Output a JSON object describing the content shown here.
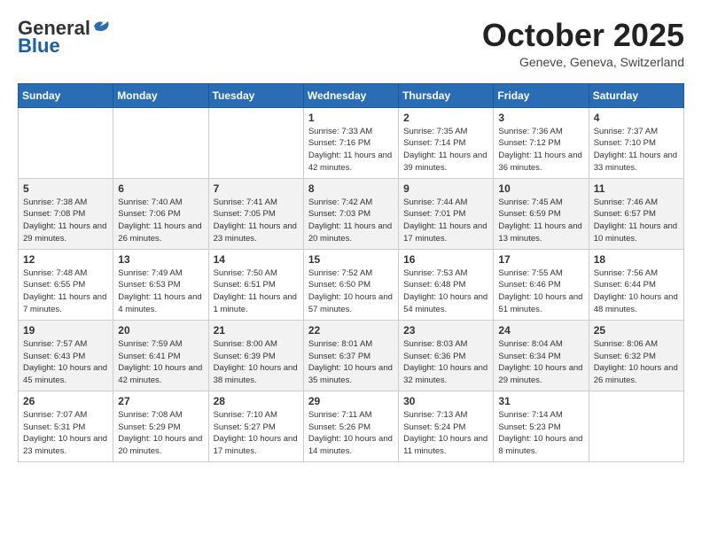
{
  "header": {
    "logo_general": "General",
    "logo_blue": "Blue",
    "month_title": "October 2025",
    "subtitle": "Geneve, Geneva, Switzerland"
  },
  "days_of_week": [
    "Sunday",
    "Monday",
    "Tuesday",
    "Wednesday",
    "Thursday",
    "Friday",
    "Saturday"
  ],
  "weeks": [
    [
      {
        "num": "",
        "sunrise": "",
        "sunset": "",
        "daylight": ""
      },
      {
        "num": "",
        "sunrise": "",
        "sunset": "",
        "daylight": ""
      },
      {
        "num": "",
        "sunrise": "",
        "sunset": "",
        "daylight": ""
      },
      {
        "num": "1",
        "sunrise": "Sunrise: 7:33 AM",
        "sunset": "Sunset: 7:16 PM",
        "daylight": "Daylight: 11 hours and 42 minutes."
      },
      {
        "num": "2",
        "sunrise": "Sunrise: 7:35 AM",
        "sunset": "Sunset: 7:14 PM",
        "daylight": "Daylight: 11 hours and 39 minutes."
      },
      {
        "num": "3",
        "sunrise": "Sunrise: 7:36 AM",
        "sunset": "Sunset: 7:12 PM",
        "daylight": "Daylight: 11 hours and 36 minutes."
      },
      {
        "num": "4",
        "sunrise": "Sunrise: 7:37 AM",
        "sunset": "Sunset: 7:10 PM",
        "daylight": "Daylight: 11 hours and 33 minutes."
      }
    ],
    [
      {
        "num": "5",
        "sunrise": "Sunrise: 7:38 AM",
        "sunset": "Sunset: 7:08 PM",
        "daylight": "Daylight: 11 hours and 29 minutes."
      },
      {
        "num": "6",
        "sunrise": "Sunrise: 7:40 AM",
        "sunset": "Sunset: 7:06 PM",
        "daylight": "Daylight: 11 hours and 26 minutes."
      },
      {
        "num": "7",
        "sunrise": "Sunrise: 7:41 AM",
        "sunset": "Sunset: 7:05 PM",
        "daylight": "Daylight: 11 hours and 23 minutes."
      },
      {
        "num": "8",
        "sunrise": "Sunrise: 7:42 AM",
        "sunset": "Sunset: 7:03 PM",
        "daylight": "Daylight: 11 hours and 20 minutes."
      },
      {
        "num": "9",
        "sunrise": "Sunrise: 7:44 AM",
        "sunset": "Sunset: 7:01 PM",
        "daylight": "Daylight: 11 hours and 17 minutes."
      },
      {
        "num": "10",
        "sunrise": "Sunrise: 7:45 AM",
        "sunset": "Sunset: 6:59 PM",
        "daylight": "Daylight: 11 hours and 13 minutes."
      },
      {
        "num": "11",
        "sunrise": "Sunrise: 7:46 AM",
        "sunset": "Sunset: 6:57 PM",
        "daylight": "Daylight: 11 hours and 10 minutes."
      }
    ],
    [
      {
        "num": "12",
        "sunrise": "Sunrise: 7:48 AM",
        "sunset": "Sunset: 6:55 PM",
        "daylight": "Daylight: 11 hours and 7 minutes."
      },
      {
        "num": "13",
        "sunrise": "Sunrise: 7:49 AM",
        "sunset": "Sunset: 6:53 PM",
        "daylight": "Daylight: 11 hours and 4 minutes."
      },
      {
        "num": "14",
        "sunrise": "Sunrise: 7:50 AM",
        "sunset": "Sunset: 6:51 PM",
        "daylight": "Daylight: 11 hours and 1 minute."
      },
      {
        "num": "15",
        "sunrise": "Sunrise: 7:52 AM",
        "sunset": "Sunset: 6:50 PM",
        "daylight": "Daylight: 10 hours and 57 minutes."
      },
      {
        "num": "16",
        "sunrise": "Sunrise: 7:53 AM",
        "sunset": "Sunset: 6:48 PM",
        "daylight": "Daylight: 10 hours and 54 minutes."
      },
      {
        "num": "17",
        "sunrise": "Sunrise: 7:55 AM",
        "sunset": "Sunset: 6:46 PM",
        "daylight": "Daylight: 10 hours and 51 minutes."
      },
      {
        "num": "18",
        "sunrise": "Sunrise: 7:56 AM",
        "sunset": "Sunset: 6:44 PM",
        "daylight": "Daylight: 10 hours and 48 minutes."
      }
    ],
    [
      {
        "num": "19",
        "sunrise": "Sunrise: 7:57 AM",
        "sunset": "Sunset: 6:43 PM",
        "daylight": "Daylight: 10 hours and 45 minutes."
      },
      {
        "num": "20",
        "sunrise": "Sunrise: 7:59 AM",
        "sunset": "Sunset: 6:41 PM",
        "daylight": "Daylight: 10 hours and 42 minutes."
      },
      {
        "num": "21",
        "sunrise": "Sunrise: 8:00 AM",
        "sunset": "Sunset: 6:39 PM",
        "daylight": "Daylight: 10 hours and 38 minutes."
      },
      {
        "num": "22",
        "sunrise": "Sunrise: 8:01 AM",
        "sunset": "Sunset: 6:37 PM",
        "daylight": "Daylight: 10 hours and 35 minutes."
      },
      {
        "num": "23",
        "sunrise": "Sunrise: 8:03 AM",
        "sunset": "Sunset: 6:36 PM",
        "daylight": "Daylight: 10 hours and 32 minutes."
      },
      {
        "num": "24",
        "sunrise": "Sunrise: 8:04 AM",
        "sunset": "Sunset: 6:34 PM",
        "daylight": "Daylight: 10 hours and 29 minutes."
      },
      {
        "num": "25",
        "sunrise": "Sunrise: 8:06 AM",
        "sunset": "Sunset: 6:32 PM",
        "daylight": "Daylight: 10 hours and 26 minutes."
      }
    ],
    [
      {
        "num": "26",
        "sunrise": "Sunrise: 7:07 AM",
        "sunset": "Sunset: 5:31 PM",
        "daylight": "Daylight: 10 hours and 23 minutes."
      },
      {
        "num": "27",
        "sunrise": "Sunrise: 7:08 AM",
        "sunset": "Sunset: 5:29 PM",
        "daylight": "Daylight: 10 hours and 20 minutes."
      },
      {
        "num": "28",
        "sunrise": "Sunrise: 7:10 AM",
        "sunset": "Sunset: 5:27 PM",
        "daylight": "Daylight: 10 hours and 17 minutes."
      },
      {
        "num": "29",
        "sunrise": "Sunrise: 7:11 AM",
        "sunset": "Sunset: 5:26 PM",
        "daylight": "Daylight: 10 hours and 14 minutes."
      },
      {
        "num": "30",
        "sunrise": "Sunrise: 7:13 AM",
        "sunset": "Sunset: 5:24 PM",
        "daylight": "Daylight: 10 hours and 11 minutes."
      },
      {
        "num": "31",
        "sunrise": "Sunrise: 7:14 AM",
        "sunset": "Sunset: 5:23 PM",
        "daylight": "Daylight: 10 hours and 8 minutes."
      },
      {
        "num": "",
        "sunrise": "",
        "sunset": "",
        "daylight": ""
      }
    ]
  ]
}
